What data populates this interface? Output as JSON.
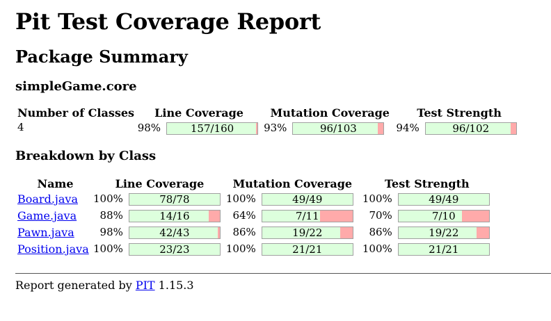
{
  "title": "Pit Test Coverage Report",
  "package_summary_heading": "Package Summary",
  "package_name": "simpleGame.core",
  "summary": {
    "headers": {
      "classes": "Number of Classes",
      "line": "Line Coverage",
      "mutation": "Mutation Coverage",
      "strength": "Test Strength"
    },
    "num_classes": "4",
    "line": {
      "pct": "98%",
      "legend": "157/160",
      "covered": 157,
      "total": 160
    },
    "mutation": {
      "pct": "93%",
      "legend": "96/103",
      "covered": 96,
      "total": 103
    },
    "strength": {
      "pct": "94%",
      "legend": "96/102",
      "covered": 96,
      "total": 102
    }
  },
  "breakdown_heading": "Breakdown by Class",
  "breakdown": {
    "headers": {
      "name": "Name",
      "line": "Line Coverage",
      "mutation": "Mutation Coverage",
      "strength": "Test Strength"
    },
    "rows": [
      {
        "name": "Board.java",
        "line": {
          "pct": "100%",
          "legend": "78/78",
          "covered": 78,
          "total": 78
        },
        "mutation": {
          "pct": "100%",
          "legend": "49/49",
          "covered": 49,
          "total": 49
        },
        "strength": {
          "pct": "100%",
          "legend": "49/49",
          "covered": 49,
          "total": 49
        }
      },
      {
        "name": "Game.java",
        "line": {
          "pct": "88%",
          "legend": "14/16",
          "covered": 14,
          "total": 16
        },
        "mutation": {
          "pct": "64%",
          "legend": "7/11",
          "covered": 7,
          "total": 11
        },
        "strength": {
          "pct": "70%",
          "legend": "7/10",
          "covered": 7,
          "total": 10
        }
      },
      {
        "name": "Pawn.java",
        "line": {
          "pct": "98%",
          "legend": "42/43",
          "covered": 42,
          "total": 43
        },
        "mutation": {
          "pct": "86%",
          "legend": "19/22",
          "covered": 19,
          "total": 22
        },
        "strength": {
          "pct": "86%",
          "legend": "19/22",
          "covered": 19,
          "total": 22
        }
      },
      {
        "name": "Position.java",
        "line": {
          "pct": "100%",
          "legend": "23/23",
          "covered": 23,
          "total": 23
        },
        "mutation": {
          "pct": "100%",
          "legend": "21/21",
          "covered": 21,
          "total": 21
        },
        "strength": {
          "pct": "100%",
          "legend": "21/21",
          "covered": 21,
          "total": 21
        }
      }
    ]
  },
  "footer": {
    "prefix": "Report generated by ",
    "link": "PIT",
    "version": " 1.15.3"
  },
  "colors": {
    "covered": "#ddffdd",
    "uncovered": "#ffaaaa",
    "link": "#0000ee"
  }
}
